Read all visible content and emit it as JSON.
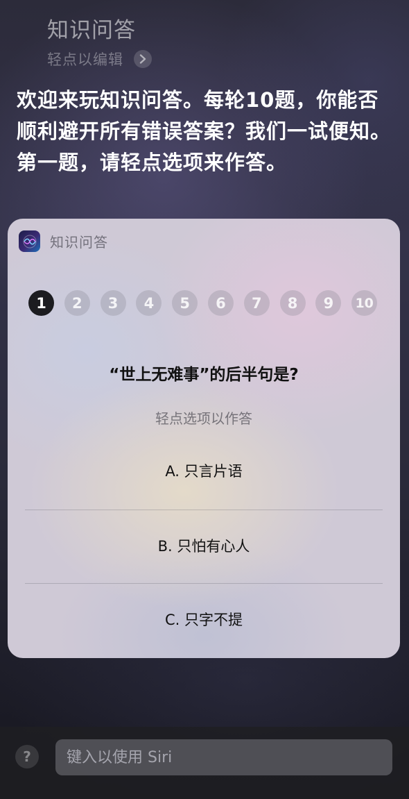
{
  "header": {
    "query": "知识问答",
    "edit_hint": "轻点以编辑"
  },
  "siri_response": "欢迎来玩知识问答。每轮10题，你能否顺利避开所有错误答案？我们一试便知。第一题，请轻点选项来作答。",
  "card": {
    "app_name": "知识问答",
    "progress": {
      "current": 1,
      "numbers": [
        "1",
        "2",
        "3",
        "4",
        "5",
        "6",
        "7",
        "8",
        "9",
        "10"
      ]
    },
    "question": "“世上无难事”的后半句是?",
    "hint": "轻点选项以作答",
    "options": [
      {
        "label": "A. 只言片语"
      },
      {
        "label": "B. 只怕有心人"
      },
      {
        "label": "C. 只字不提"
      }
    ]
  },
  "bottom_bar": {
    "help_label": "?",
    "input_placeholder": "键入以使用 Siri"
  }
}
